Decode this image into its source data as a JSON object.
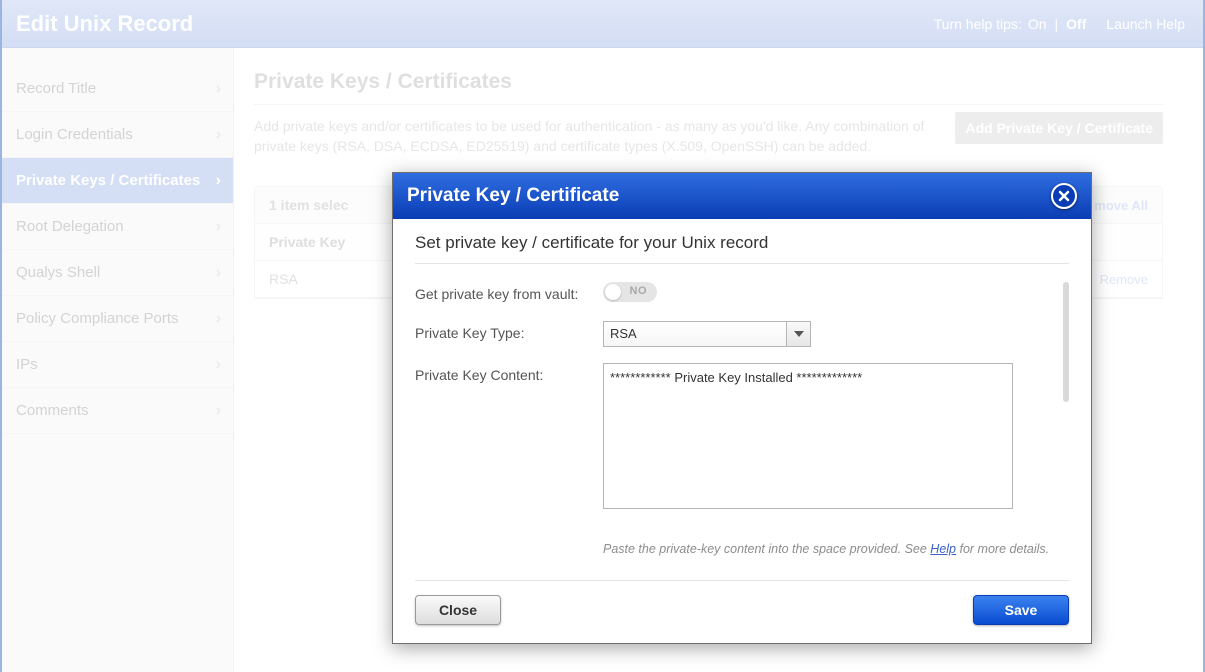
{
  "header": {
    "title": "Edit Unix Record",
    "help_tips_label": "Turn help tips:",
    "help_on": "On",
    "help_off": "Off",
    "launch_help": "Launch Help"
  },
  "sidebar": {
    "items": [
      {
        "label": "Record Title"
      },
      {
        "label": "Login Credentials"
      },
      {
        "label": "Private Keys / Certificates"
      },
      {
        "label": "Root Delegation"
      },
      {
        "label": "Qualys Shell"
      },
      {
        "label": "Policy Compliance Ports"
      },
      {
        "label": "IPs"
      },
      {
        "label": "Comments"
      }
    ],
    "active_index": 2
  },
  "main": {
    "page_title": "Private Keys / Certificates",
    "desc": "Add private keys and/or certificates to be used for authentication - as many as you'd like. Any combination of private keys (RSA, DSA, ECDSA, ED25519) and certificate types (X.509, OpenSSH) can be added.",
    "add_button": "Add Private Key / Certificate",
    "table": {
      "selected_text": "1 item selec",
      "remove_all": "move All",
      "col_header": "Private Key",
      "row1_value": "RSA",
      "row1_remove": "Remove"
    }
  },
  "modal": {
    "title": "Private Key / Certificate",
    "subtitle": "Set private key / certificate for your Unix record",
    "labels": {
      "vault": "Get private key from vault:",
      "type": "Private Key Type:",
      "content": "Private Key Content:"
    },
    "vault_toggle": "NO",
    "type_value": "RSA",
    "content_value": "************ Private Key Installed *************",
    "hint_pre": "Paste the private-key content into the space provided. See ",
    "hint_link": "Help",
    "hint_post": " for more details.",
    "close": "Close",
    "save": "Save"
  }
}
